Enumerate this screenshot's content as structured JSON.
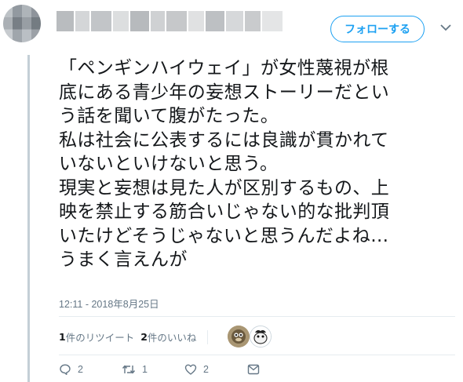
{
  "header": {
    "follow_label": "フォローする"
  },
  "tweet": {
    "text": "「ペンギンハイウェイ」が女性蔑視が根\n底にある青少年の妄想ストーリーだとい\nう話を聞いて腹がたった。\n私は社会に公表するには良識が貫かれて\nいないといけないと思う。\n現実と妄想は見た人が区別するもの、上\n映を禁止する筋合いじゃない的な批判頂\nいたけどそうじゃないと思うんだよね…\nうまく言えんが",
    "timestamp": "12:11 - 2018年8月25日"
  },
  "stats": {
    "retweet_count": "1",
    "retweet_label": "件のリツイート",
    "like_count": "2",
    "like_label": "件のいいね"
  },
  "actions": {
    "reply_count": "2",
    "retweet_count": "1",
    "like_count": "2"
  },
  "colors": {
    "accent": "#1da1f2",
    "muted": "#657786",
    "border": "#e6ecf0"
  }
}
